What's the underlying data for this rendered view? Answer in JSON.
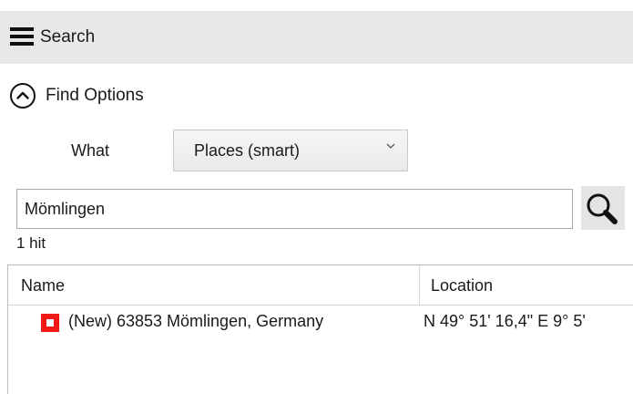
{
  "header": {
    "title": "Search",
    "menu_icon": "hamburger-icon"
  },
  "find_options": {
    "label": "Find Options",
    "toggle_icon": "chevron-up-circle-icon",
    "what_label": "What",
    "what_value": "Places (smart)",
    "what_arrow_icon": "chevron-down-icon"
  },
  "search": {
    "value": "Mömlingen",
    "button_icon": "magnifier-icon"
  },
  "results": {
    "count_text": "1 hit",
    "columns": {
      "name": "Name",
      "location": "Location"
    },
    "rows": [
      {
        "icon": "place-marker-icon",
        "name": "(New) 63853 Mömlingen, Germany",
        "location": "N 49° 51' 16,4\" E 9° 5'"
      }
    ]
  },
  "colors": {
    "header_bg": "#e8e8e8",
    "marker": "#f01818"
  }
}
